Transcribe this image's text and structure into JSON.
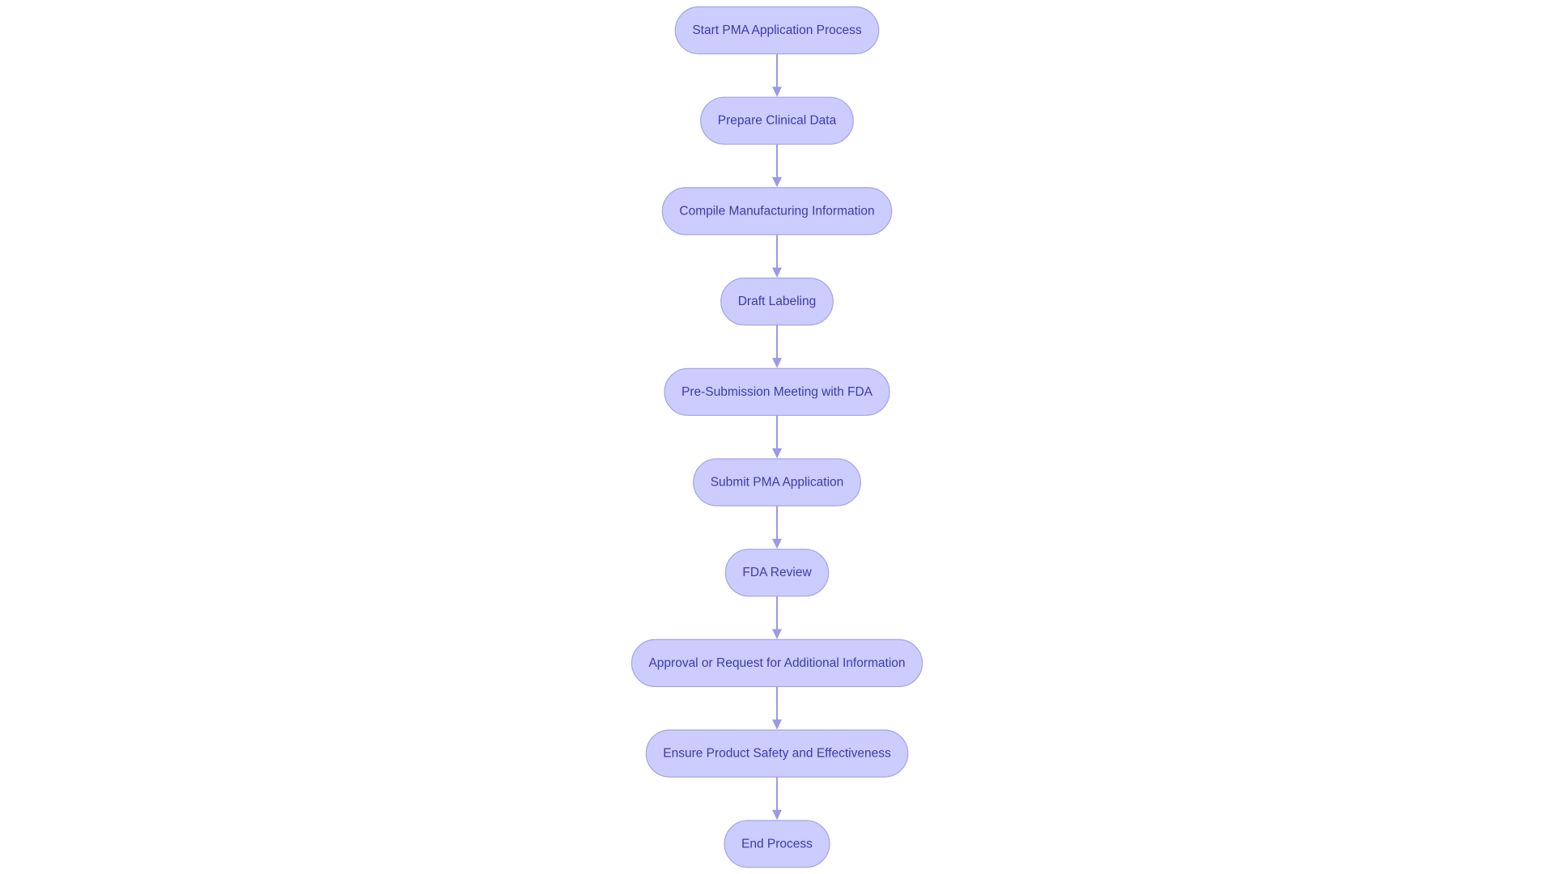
{
  "diagram": {
    "type": "flowchart",
    "direction": "top-down",
    "colors": {
      "node_fill": "#ccccff",
      "node_stroke": "#a3a3e8",
      "text": "#3b3bab",
      "edge": "#9a9ae6"
    },
    "nodes": [
      {
        "id": "start",
        "label": "Start PMA Application Process"
      },
      {
        "id": "clinical",
        "label": "Prepare Clinical Data"
      },
      {
        "id": "manufacturing",
        "label": "Compile Manufacturing Information"
      },
      {
        "id": "labeling",
        "label": "Draft Labeling"
      },
      {
        "id": "presub",
        "label": "Pre-Submission Meeting with FDA"
      },
      {
        "id": "submit",
        "label": "Submit PMA Application"
      },
      {
        "id": "review",
        "label": "FDA Review"
      },
      {
        "id": "approval",
        "label": "Approval or Request for Additional Information"
      },
      {
        "id": "safety",
        "label": "Ensure Product Safety and Effectiveness"
      },
      {
        "id": "end",
        "label": "End Process"
      }
    ],
    "edges": [
      {
        "from": "start",
        "to": "clinical"
      },
      {
        "from": "clinical",
        "to": "manufacturing"
      },
      {
        "from": "manufacturing",
        "to": "labeling"
      },
      {
        "from": "labeling",
        "to": "presub"
      },
      {
        "from": "presub",
        "to": "submit"
      },
      {
        "from": "submit",
        "to": "review"
      },
      {
        "from": "review",
        "to": "approval"
      },
      {
        "from": "approval",
        "to": "safety"
      },
      {
        "from": "safety",
        "to": "end"
      }
    ]
  }
}
